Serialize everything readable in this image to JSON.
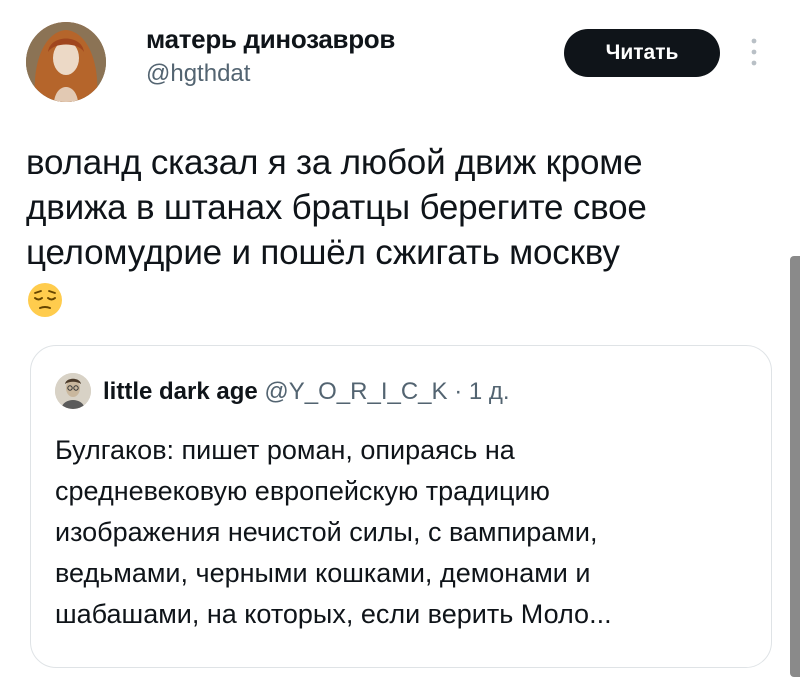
{
  "author": {
    "name": "матерь динозавров",
    "handle": "@hgthdat"
  },
  "follow_button": {
    "label": "Читать"
  },
  "more_icon": "vertical-ellipsis",
  "tweet": {
    "lines": [
      "воланд сказал я за любой движ кроме",
      "движа в штанах братцы берегите свое",
      "целомудрие и пошёл сжигать москву"
    ],
    "emoji": "pensive-face"
  },
  "quote": {
    "name": "little dark age",
    "handle": "@Y_O_R_I_C_K",
    "separator": "·",
    "time": "1 д.",
    "lines": [
      "Булгаков: пишет роман, опираясь на",
      "средневековую европейскую традицию",
      "изображения нечистой силы, с вампирами,",
      "ведьмами, черными кошками, демонами и",
      "шабашами, на которых, если верить Моло..."
    ]
  },
  "colors": {
    "text": "#0f1419",
    "secondary": "#536471",
    "button_bg": "#0f1419",
    "border": "#dfe3e6",
    "scrollbar": "#8a8a8a"
  }
}
